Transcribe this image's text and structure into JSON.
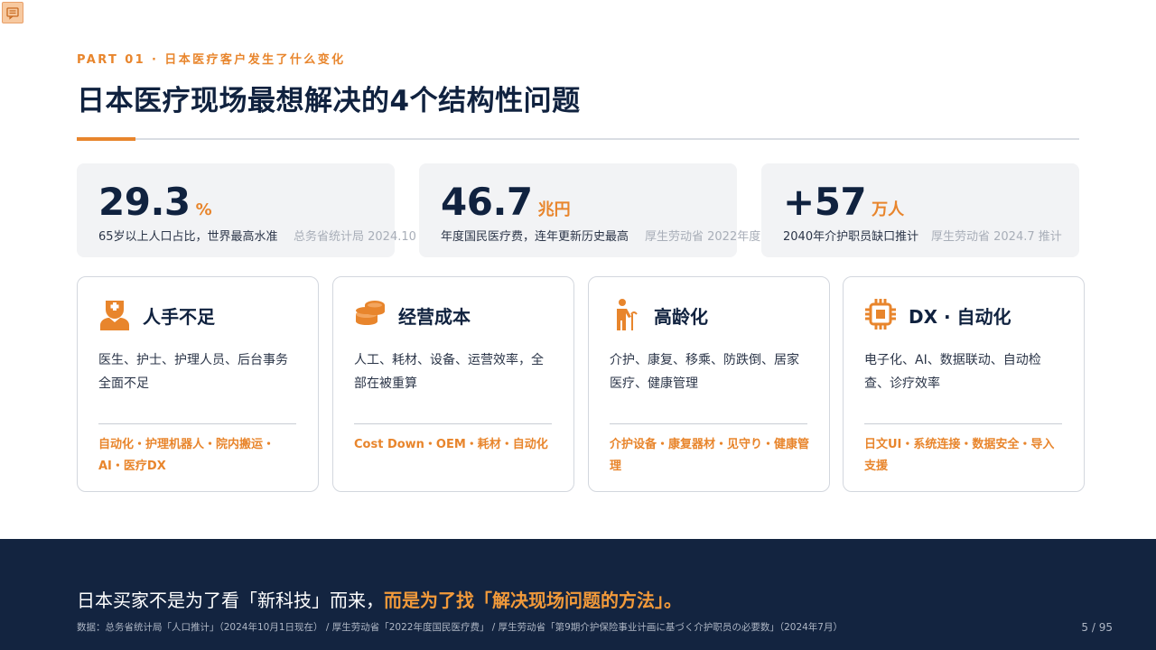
{
  "header": {
    "eyebrow": "PART 01 · 日本医疗客户发生了什么变化",
    "title": "日本医疗现场最想解决的4个结构性问题"
  },
  "stats": [
    {
      "number": "29.3",
      "unit": "%",
      "desc": "65岁以上人口占比，世界最高水准",
      "source": "总务省统计局 2024.10"
    },
    {
      "number": "46.7",
      "unit": "兆円",
      "desc": "年度国民医疗费，连年更新历史最高",
      "source": "厚生劳动省 2022年度"
    },
    {
      "number": "+57",
      "unit": "万人",
      "desc": "2040年介护职员缺口推计",
      "source": "厚生劳动省 2024.7 推计"
    }
  ],
  "cards": [
    {
      "icon": "nurse-icon",
      "title": "人手不足",
      "body": "医生、护士、护理人员、后台事务全面不足",
      "tags": "自动化・护理机器人・院内搬运・AI・医疗DX"
    },
    {
      "icon": "coins-icon",
      "title": "经营成本",
      "body": "人工、耗材、设备、运营效率，全部在被重算",
      "tags": "Cost Down・OEM・耗材・自动化"
    },
    {
      "icon": "elderly-icon",
      "title": "高龄化",
      "body": "介护、康复、移乘、防跌倒、居家医疗、健康管理",
      "tags": "介护设备・康复器材・见守り・健康管理"
    },
    {
      "icon": "chip-icon",
      "title": "DX · 自动化",
      "body": "电子化、AI、数据联动、自动检查、诊疗效率",
      "tags": "日文UI・系统连接・数据安全・导入支援"
    }
  ],
  "footer": {
    "headline_prefix": "日本买家不是为了看「新科技」而来，",
    "headline_highlight": "而是为了找「解决现场问题的方法」。",
    "sources": "数据：总务省统计局「人口推计」（2024年10月1日现在） / 厚生劳动省「2022年度国民医疗费」 / 厚生劳动省「第9期介护保险事业计画に基づく介护职员の必要数」（2024年7月）",
    "page": "5 / 95"
  },
  "colors": {
    "accent": "#e8852c",
    "navy": "#10223f",
    "footer_bg": "#132440"
  }
}
